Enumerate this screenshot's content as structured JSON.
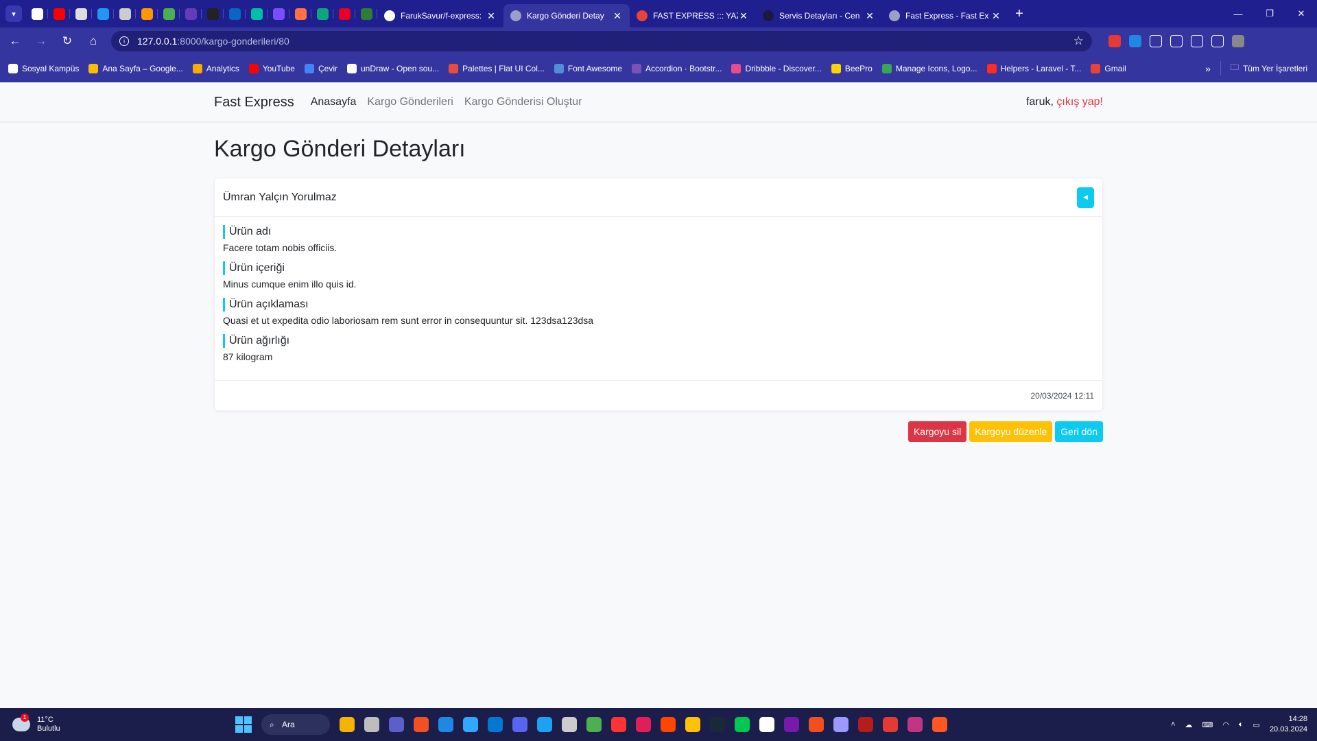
{
  "browser": {
    "tabs": [
      {
        "title": "FarukSavur/f-express:",
        "favicon_color": "#ffffff",
        "active": false
      },
      {
        "title": "Kargo Gönderi Detay",
        "favicon_color": "#9aa0c8",
        "active": true
      },
      {
        "title": "FAST EXPRESS ::: YAZI",
        "favicon_color": "#ea4335",
        "active": false
      },
      {
        "title": "Servis Detayları - Cen",
        "favicon_color": "#1a1a40",
        "active": false
      },
      {
        "title": "Fast Express - Fast Ex",
        "favicon_color": "#9aa0c8",
        "active": false
      }
    ],
    "pinned_tab_colors": [
      "#ffffff",
      "#ff0000",
      "#dddddd",
      "#2196f3",
      "#cccccc",
      "#ff9800",
      "#4caf50",
      "#673ab7",
      "#222222",
      "#0a66c2",
      "#00bfa5",
      "#7c4dff",
      "#ff7043",
      "#10a37f",
      "#e60023",
      "#2e7d32"
    ],
    "url_host": "127.0.0.1",
    "url_path": ":8000/kargo-gonderileri/80",
    "extension_colors": [
      "#e53935",
      "#1e88e5",
      "#ffffff",
      "#ffffff",
      "#ffffff",
      "#ffffff",
      "#888888"
    ],
    "bookmarks": [
      {
        "label": "Sosyal Kampüs",
        "color": "#ffffff"
      },
      {
        "label": "Ana Sayfa – Google...",
        "color": "#fbbc04"
      },
      {
        "label": "Analytics",
        "color": "#f9ab00"
      },
      {
        "label": "YouTube",
        "color": "#ff0000"
      },
      {
        "label": "Çevir",
        "color": "#4285f4"
      },
      {
        "label": "unDraw - Open sou...",
        "color": "#ffffff"
      },
      {
        "label": "Palettes | Flat UI Col...",
        "color": "#e74c3c"
      },
      {
        "label": "Font Awesome",
        "color": "#528dd7"
      },
      {
        "label": "Accordion · Bootstr...",
        "color": "#7952b3"
      },
      {
        "label": "Dribbble - Discover...",
        "color": "#ea4c89"
      },
      {
        "label": "BeePro",
        "color": "#ffd400"
      },
      {
        "label": "Manage Icons, Logo...",
        "color": "#34a853"
      },
      {
        "label": "Helpers - Laravel - T...",
        "color": "#ff2d20"
      },
      {
        "label": "Gmail",
        "color": "#ea4335"
      }
    ],
    "all_bookmarks_label": "Tüm Yer İşaretleri"
  },
  "navbar": {
    "brand": "Fast Express",
    "links": [
      {
        "label": "Anasayfa",
        "active": true
      },
      {
        "label": "Kargo Gönderileri",
        "active": false
      },
      {
        "label": "Kargo Gönderisi Oluştur",
        "active": false
      }
    ],
    "user_name": "faruk,",
    "logout_label": "çıkış yap!"
  },
  "page": {
    "title": "Kargo Gönderi Detayları",
    "card": {
      "customer_name": "Ümran Yalçın Yorulmaz",
      "fields": [
        {
          "label": "Ürün adı",
          "value": "Facere totam nobis officiis."
        },
        {
          "label": "Ürün içeriği",
          "value": "Minus cumque enim illo quis id."
        },
        {
          "label": "Ürün açıklaması",
          "value": "Quasi et ut expedita odio laboriosam rem sunt error in consequuntur sit. 123dsa123dsa"
        },
        {
          "label": "Ürün ağırlığı",
          "value": "87 kilogram"
        }
      ],
      "timestamp": "20/03/2024 12:11"
    },
    "actions": {
      "delete_label": "Kargoyu sil",
      "edit_label": "Kargoyu düzenle",
      "back_label": "Geri dön"
    }
  },
  "taskbar": {
    "weather_temp": "11°C",
    "weather_desc": "Bulutlu",
    "search_label": "Ara",
    "app_colors": [
      "#f5b400",
      "#bdbdbd",
      "#5b5fc7",
      "#f25022",
      "#1e88e5",
      "#31a8ff",
      "#0078d4",
      "#5865f2",
      "#1da1f2",
      "#cccccc",
      "#4caf50",
      "#ff3333",
      "#e01e5a",
      "#ff4500",
      "#ffc107",
      "#1b2838",
      "#00c853",
      "#ffffff",
      "#7719aa",
      "#f24e1e",
      "#9999ff",
      "#b71c1c",
      "#e53935",
      "#c13584",
      "#ff5722"
    ],
    "time": "14:28",
    "date": "20.03.2024"
  }
}
